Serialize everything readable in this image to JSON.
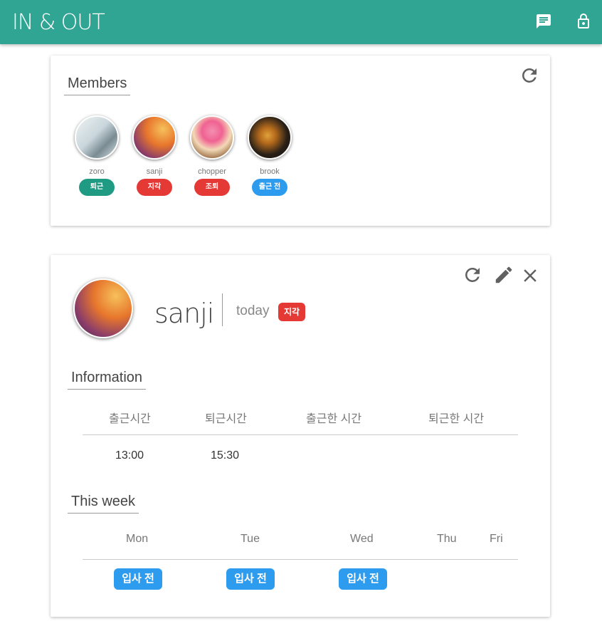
{
  "app": {
    "title": "IN & OUT"
  },
  "toolbar": {
    "icons": [
      "message-icon",
      "lock-icon"
    ]
  },
  "members_card": {
    "title": "Members",
    "members": [
      {
        "name": "zoro",
        "status": "퇴근",
        "status_color": "#1f9a83"
      },
      {
        "name": "sanji",
        "status": "지각",
        "status_color": "#e53935"
      },
      {
        "name": "chopper",
        "status": "조퇴",
        "status_color": "#e53935"
      },
      {
        "name": "brook",
        "status": "출근 전",
        "status_color": "#2d9bee"
      }
    ]
  },
  "detail": {
    "name": "sanji",
    "today_label": "today",
    "today_status": "지각",
    "information": {
      "title": "Information",
      "headers": [
        "출근시간",
        "퇴근시간",
        "출근한 시간",
        "퇴근한 시간"
      ],
      "values": [
        "13:00",
        "15:30",
        "",
        ""
      ]
    },
    "week": {
      "title": "This week",
      "days": [
        "Mon",
        "Tue",
        "Wed",
        "Thu",
        "Fri"
      ],
      "statuses": [
        "입사 전",
        "입사 전",
        "입사 전",
        "",
        ""
      ]
    }
  },
  "colors": {
    "accent": "#30a594",
    "late": "#e53935",
    "before": "#2d9bee",
    "left": "#1f9a83"
  }
}
